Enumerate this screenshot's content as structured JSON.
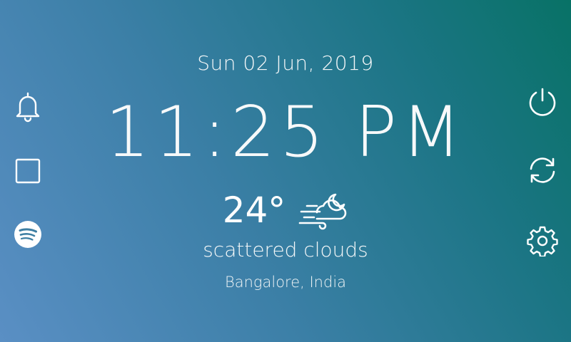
{
  "clock": {
    "date": "Sun 02 Jun, 2019",
    "time": "11:25 PM"
  },
  "weather": {
    "temperature": "24°",
    "description": "scattered clouds",
    "location": "Bangalore, India",
    "icon": "windy-cloud-moon-icon"
  },
  "left_menu": {
    "items": [
      {
        "icon": "bell-icon",
        "action": "alarm"
      },
      {
        "icon": "square-icon",
        "action": "screen"
      },
      {
        "icon": "spotify-icon",
        "action": "spotify"
      }
    ]
  },
  "right_menu": {
    "items": [
      {
        "icon": "power-icon",
        "action": "power"
      },
      {
        "icon": "refresh-icon",
        "action": "refresh"
      },
      {
        "icon": "gear-icon",
        "action": "settings"
      }
    ]
  },
  "colors": {
    "gradient_start": "#5a8fc4",
    "gradient_end": "#087266",
    "foreground": "#ffffff"
  }
}
